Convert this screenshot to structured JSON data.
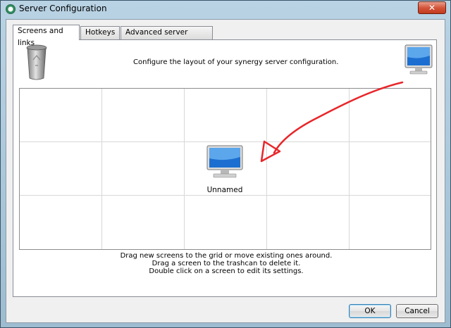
{
  "window": {
    "title": "Server Configuration",
    "close_label": "✕"
  },
  "tabs": [
    {
      "label": "Screens and links",
      "active": true
    },
    {
      "label": "Hotkeys",
      "active": false
    },
    {
      "label": "Advanced server settings",
      "active": false
    }
  ],
  "panel": {
    "hint_top": "Configure the layout of your synergy server configuration.",
    "grid": {
      "columns": 5,
      "rows": 3
    },
    "screen": {
      "label": "Unnamed"
    },
    "hint_bottom": [
      "Drag new screens to the grid or move existing ones around.",
      "Drag a screen to the trashcan to delete it.",
      "Double click on a screen to edit its settings."
    ],
    "annotation_color": "#e8262a"
  },
  "buttons": {
    "ok": "OK",
    "cancel": "Cancel"
  }
}
